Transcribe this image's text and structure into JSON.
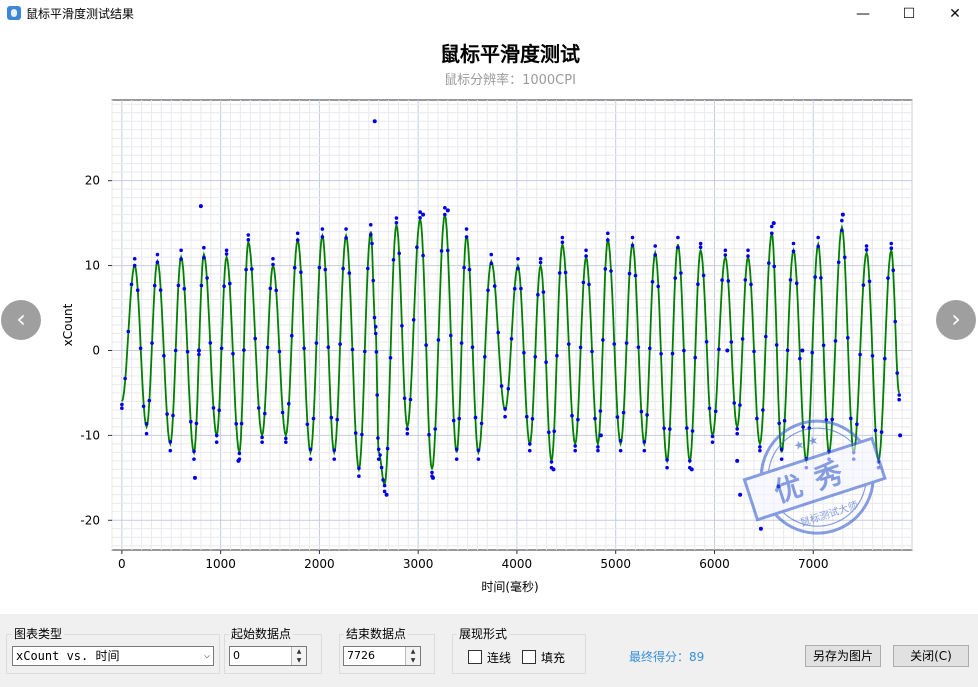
{
  "window": {
    "title": "鼠标平滑度测试结果",
    "minimize": "—",
    "maximize": "☐",
    "close": "✕"
  },
  "nav": {
    "prev": "‹",
    "next": "›"
  },
  "chart_data": {
    "type": "line",
    "title": "鼠标平滑度测试",
    "subtitle": "鼠标分辨率：1000CPI",
    "xlabel": "时间(毫秒)",
    "ylabel": "xCount",
    "xlim": [
      -100,
      8000
    ],
    "ylim": [
      -23.5,
      29.5
    ],
    "xticks": [
      0,
      1000,
      2000,
      3000,
      4000,
      5000,
      6000,
      7000
    ],
    "yticks": [
      -20,
      -10,
      0,
      10,
      20
    ],
    "grid": true,
    "series": [
      {
        "color": "#008000",
        "style": "smooth-line",
        "peaks": [
          [
            0,
            -6
          ],
          [
            130,
            10
          ],
          [
            250,
            -9
          ],
          [
            360,
            10.5
          ],
          [
            490,
            -11
          ],
          [
            600,
            11
          ],
          [
            730,
            -12
          ],
          [
            830,
            11.3
          ],
          [
            960,
            -10
          ],
          [
            1060,
            11
          ],
          [
            1190,
            -12
          ],
          [
            1280,
            12.8
          ],
          [
            1420,
            -10
          ],
          [
            1530,
            10
          ],
          [
            1660,
            -10
          ],
          [
            1780,
            13
          ],
          [
            1910,
            -12
          ],
          [
            2030,
            13.5
          ],
          [
            2150,
            -12
          ],
          [
            2270,
            13.5
          ],
          [
            2400,
            -14
          ],
          [
            2520,
            14
          ],
          [
            2570,
            2
          ],
          [
            2600,
            -12
          ],
          [
            2660,
            -15.8
          ],
          [
            2780,
            14.8
          ],
          [
            2890,
            -9
          ],
          [
            3020,
            15.5
          ],
          [
            3140,
            -14
          ],
          [
            3270,
            16
          ],
          [
            3390,
            -12
          ],
          [
            3490,
            13.5
          ],
          [
            3610,
            -12
          ],
          [
            3740,
            10.5
          ],
          [
            3880,
            -7
          ],
          [
            4010,
            10
          ],
          [
            4130,
            -11
          ],
          [
            4240,
            10
          ],
          [
            4350,
            -13
          ],
          [
            4460,
            12.5
          ],
          [
            4590,
            -11
          ],
          [
            4700,
            11
          ],
          [
            4820,
            -11
          ],
          [
            4920,
            13
          ],
          [
            5050,
            -11
          ],
          [
            5170,
            12.5
          ],
          [
            5290,
            -11
          ],
          [
            5400,
            11.5
          ],
          [
            5520,
            -13
          ],
          [
            5630,
            12.5
          ],
          [
            5750,
            -13
          ],
          [
            5860,
            11.8
          ],
          [
            5980,
            -10
          ],
          [
            6110,
            11
          ],
          [
            6230,
            -9
          ],
          [
            6340,
            11
          ],
          [
            6460,
            -11
          ],
          [
            6580,
            13.8
          ],
          [
            6680,
            -12
          ],
          [
            6800,
            11.8
          ],
          [
            6930,
            -13
          ],
          [
            7050,
            12.5
          ],
          [
            7160,
            -12
          ],
          [
            7290,
            14.5
          ],
          [
            7410,
            -12
          ],
          [
            7540,
            11.5
          ],
          [
            7660,
            -13
          ],
          [
            7790,
            11.8
          ],
          [
            7870,
            -5
          ]
        ],
        "outliers": [
          [
            800,
            17
          ],
          [
            2560,
            27
          ],
          [
            3050,
            16
          ],
          [
            3300,
            16.5
          ],
          [
            740,
            -15
          ],
          [
            2680,
            -17
          ],
          [
            3150,
            -15
          ],
          [
            4370,
            -14
          ],
          [
            6260,
            -17
          ],
          [
            6470,
            -21
          ],
          [
            6650,
            -16
          ],
          [
            5770,
            -14
          ],
          [
            7300,
            16
          ],
          [
            6600,
            15
          ],
          [
            1180,
            -13
          ],
          [
            4850,
            -10
          ],
          [
            6230,
            -13
          ],
          [
            780,
            0
          ],
          [
            6130,
            0
          ],
          [
            6890,
            0
          ],
          [
            7880,
            -10
          ]
        ]
      }
    ],
    "scatter_color": "#0000e6"
  },
  "stamp": {
    "main": "优秀",
    "sub": "鼠标测试大师",
    "color": "#3a5fd0"
  },
  "controls": {
    "chart_type": {
      "label": "图表类型",
      "value": "xCount vs. 时间"
    },
    "start_point": {
      "label": "起始数据点",
      "value": "0"
    },
    "end_point": {
      "label": "结束数据点",
      "value": "7726"
    },
    "display": {
      "label": "展现形式",
      "connect": "连线",
      "fill": "填充"
    },
    "score": "最终得分：89",
    "save_button": "另存为图片",
    "close_button": "关闭(C)"
  }
}
